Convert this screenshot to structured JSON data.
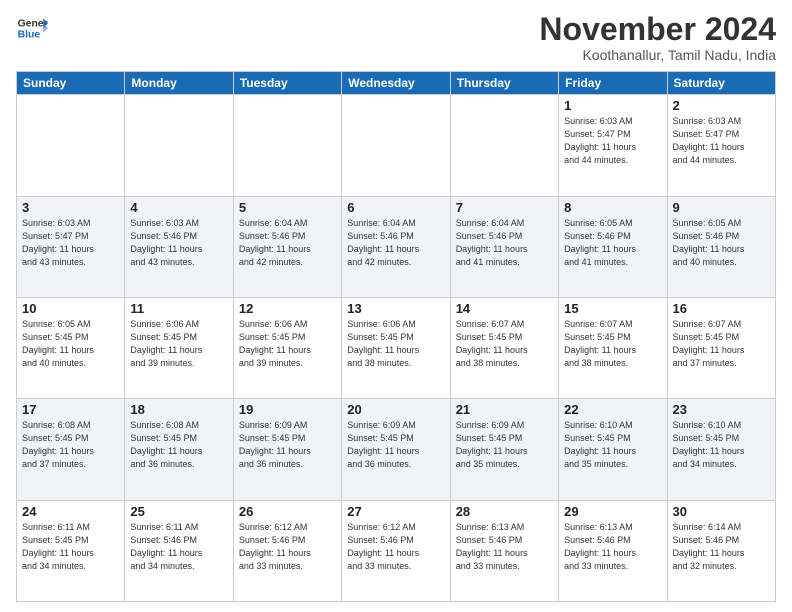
{
  "logo": {
    "general": "General",
    "blue": "Blue"
  },
  "title": "November 2024",
  "location": "Koothanallur, Tamil Nadu, India",
  "headers": [
    "Sunday",
    "Monday",
    "Tuesday",
    "Wednesday",
    "Thursday",
    "Friday",
    "Saturday"
  ],
  "weeks": [
    [
      {
        "day": "",
        "info": ""
      },
      {
        "day": "",
        "info": ""
      },
      {
        "day": "",
        "info": ""
      },
      {
        "day": "",
        "info": ""
      },
      {
        "day": "",
        "info": ""
      },
      {
        "day": "1",
        "info": "Sunrise: 6:03 AM\nSunset: 5:47 PM\nDaylight: 11 hours\nand 44 minutes."
      },
      {
        "day": "2",
        "info": "Sunrise: 6:03 AM\nSunset: 5:47 PM\nDaylight: 11 hours\nand 44 minutes."
      }
    ],
    [
      {
        "day": "3",
        "info": "Sunrise: 6:03 AM\nSunset: 5:47 PM\nDaylight: 11 hours\nand 43 minutes."
      },
      {
        "day": "4",
        "info": "Sunrise: 6:03 AM\nSunset: 5:46 PM\nDaylight: 11 hours\nand 43 minutes."
      },
      {
        "day": "5",
        "info": "Sunrise: 6:04 AM\nSunset: 5:46 PM\nDaylight: 11 hours\nand 42 minutes."
      },
      {
        "day": "6",
        "info": "Sunrise: 6:04 AM\nSunset: 5:46 PM\nDaylight: 11 hours\nand 42 minutes."
      },
      {
        "day": "7",
        "info": "Sunrise: 6:04 AM\nSunset: 5:46 PM\nDaylight: 11 hours\nand 41 minutes."
      },
      {
        "day": "8",
        "info": "Sunrise: 6:05 AM\nSunset: 5:46 PM\nDaylight: 11 hours\nand 41 minutes."
      },
      {
        "day": "9",
        "info": "Sunrise: 6:05 AM\nSunset: 5:46 PM\nDaylight: 11 hours\nand 40 minutes."
      }
    ],
    [
      {
        "day": "10",
        "info": "Sunrise: 6:05 AM\nSunset: 5:45 PM\nDaylight: 11 hours\nand 40 minutes."
      },
      {
        "day": "11",
        "info": "Sunrise: 6:06 AM\nSunset: 5:45 PM\nDaylight: 11 hours\nand 39 minutes."
      },
      {
        "day": "12",
        "info": "Sunrise: 6:06 AM\nSunset: 5:45 PM\nDaylight: 11 hours\nand 39 minutes."
      },
      {
        "day": "13",
        "info": "Sunrise: 6:06 AM\nSunset: 5:45 PM\nDaylight: 11 hours\nand 38 minutes."
      },
      {
        "day": "14",
        "info": "Sunrise: 6:07 AM\nSunset: 5:45 PM\nDaylight: 11 hours\nand 38 minutes."
      },
      {
        "day": "15",
        "info": "Sunrise: 6:07 AM\nSunset: 5:45 PM\nDaylight: 11 hours\nand 38 minutes."
      },
      {
        "day": "16",
        "info": "Sunrise: 6:07 AM\nSunset: 5:45 PM\nDaylight: 11 hours\nand 37 minutes."
      }
    ],
    [
      {
        "day": "17",
        "info": "Sunrise: 6:08 AM\nSunset: 5:45 PM\nDaylight: 11 hours\nand 37 minutes."
      },
      {
        "day": "18",
        "info": "Sunrise: 6:08 AM\nSunset: 5:45 PM\nDaylight: 11 hours\nand 36 minutes."
      },
      {
        "day": "19",
        "info": "Sunrise: 6:09 AM\nSunset: 5:45 PM\nDaylight: 11 hours\nand 36 minutes."
      },
      {
        "day": "20",
        "info": "Sunrise: 6:09 AM\nSunset: 5:45 PM\nDaylight: 11 hours\nand 36 minutes."
      },
      {
        "day": "21",
        "info": "Sunrise: 6:09 AM\nSunset: 5:45 PM\nDaylight: 11 hours\nand 35 minutes."
      },
      {
        "day": "22",
        "info": "Sunrise: 6:10 AM\nSunset: 5:45 PM\nDaylight: 11 hours\nand 35 minutes."
      },
      {
        "day": "23",
        "info": "Sunrise: 6:10 AM\nSunset: 5:45 PM\nDaylight: 11 hours\nand 34 minutes."
      }
    ],
    [
      {
        "day": "24",
        "info": "Sunrise: 6:11 AM\nSunset: 5:45 PM\nDaylight: 11 hours\nand 34 minutes."
      },
      {
        "day": "25",
        "info": "Sunrise: 6:11 AM\nSunset: 5:46 PM\nDaylight: 11 hours\nand 34 minutes."
      },
      {
        "day": "26",
        "info": "Sunrise: 6:12 AM\nSunset: 5:46 PM\nDaylight: 11 hours\nand 33 minutes."
      },
      {
        "day": "27",
        "info": "Sunrise: 6:12 AM\nSunset: 5:46 PM\nDaylight: 11 hours\nand 33 minutes."
      },
      {
        "day": "28",
        "info": "Sunrise: 6:13 AM\nSunset: 5:46 PM\nDaylight: 11 hours\nand 33 minutes."
      },
      {
        "day": "29",
        "info": "Sunrise: 6:13 AM\nSunset: 5:46 PM\nDaylight: 11 hours\nand 33 minutes."
      },
      {
        "day": "30",
        "info": "Sunrise: 6:14 AM\nSunset: 5:46 PM\nDaylight: 11 hours\nand 32 minutes."
      }
    ]
  ]
}
